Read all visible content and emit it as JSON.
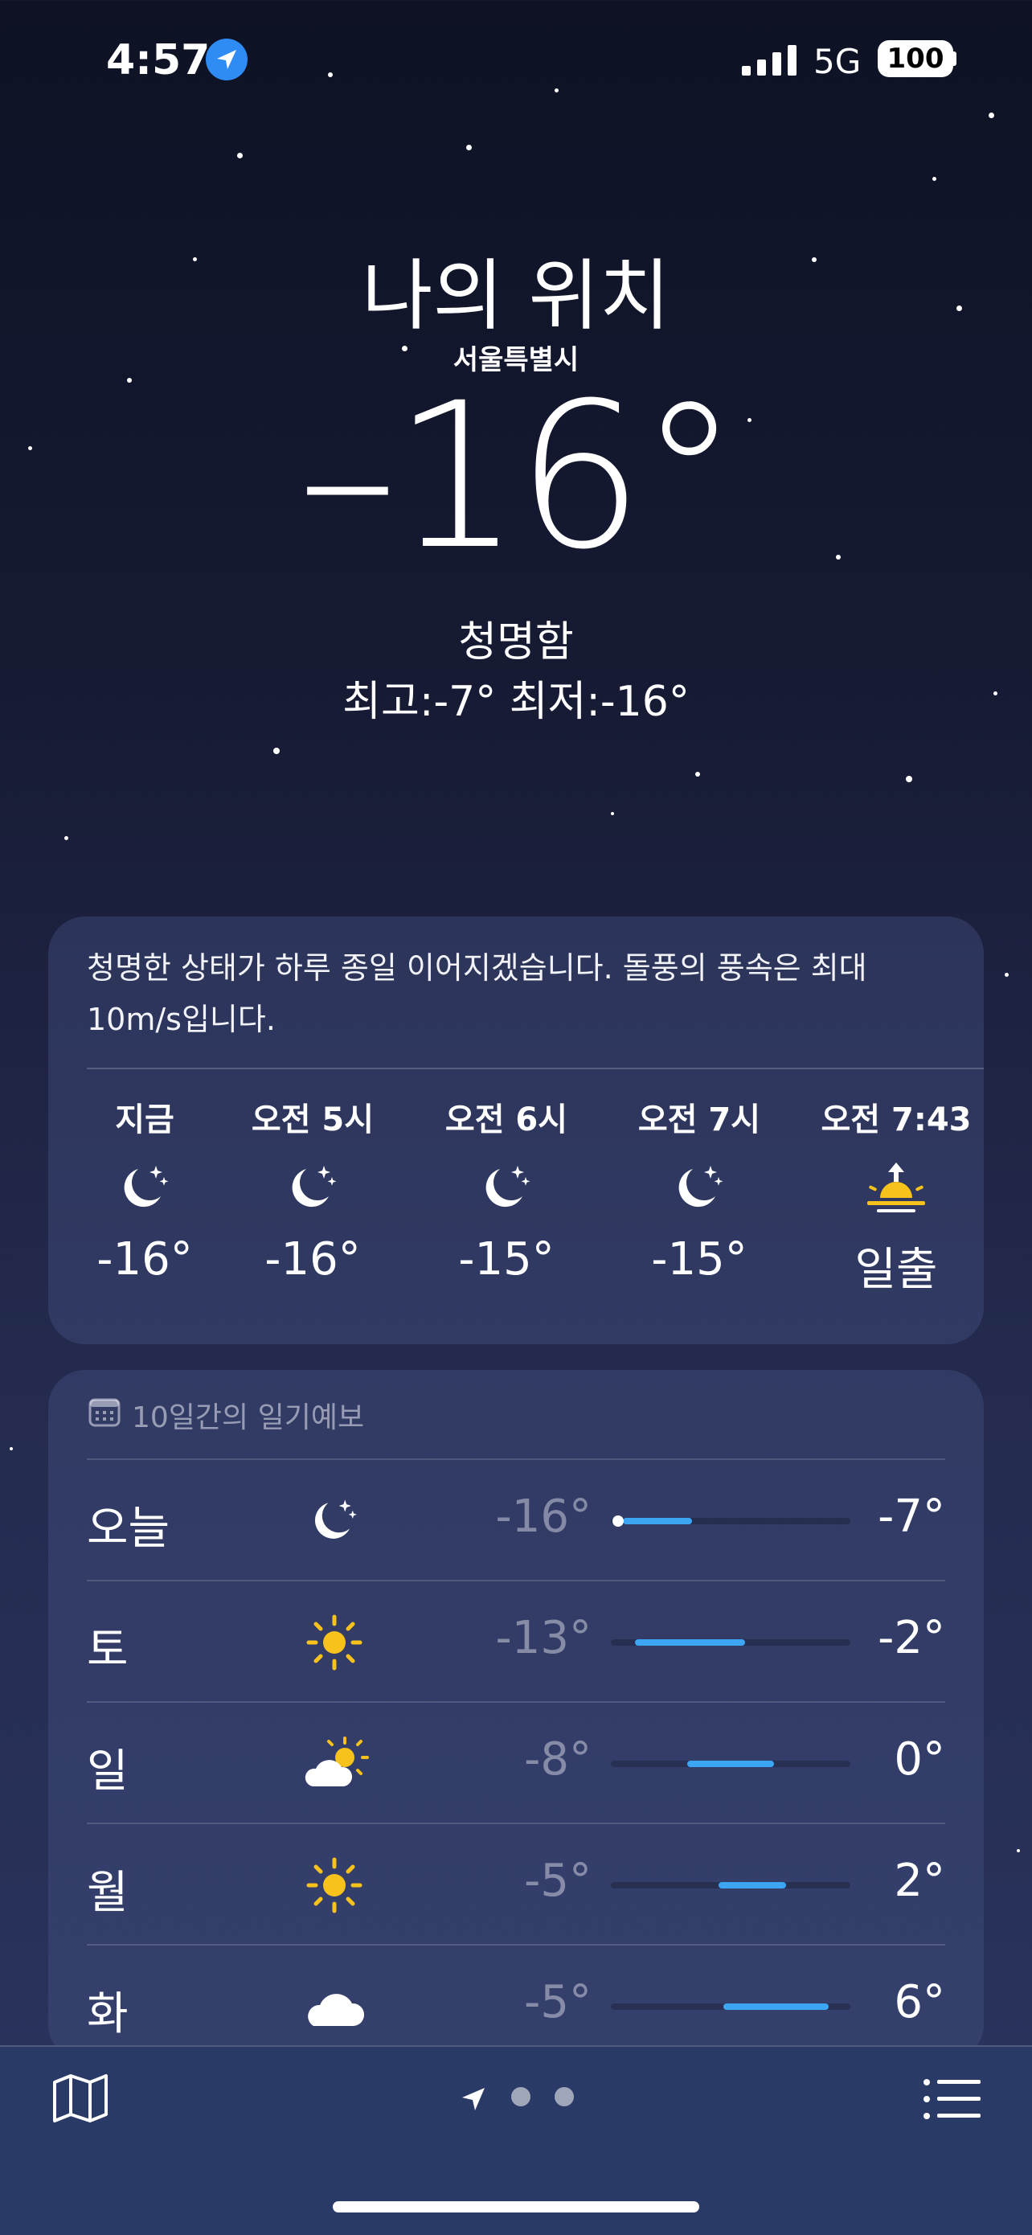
{
  "status": {
    "time": "4:57",
    "network": "5G",
    "battery": "100"
  },
  "header": {
    "location_title": "나의 위치",
    "location_subtitle": "서울특별시",
    "current_temp": "–16°",
    "condition": "청명함",
    "high_low": "최고:-7°  최저:-16°"
  },
  "summary": {
    "text": "청명한 상태가 하루 종일 이어지겠습니다. 돌풍의 풍속은 최대 10m/s입니다.",
    "hours": [
      {
        "time": "지금",
        "icon": "moon-stars-icon",
        "temp": "-16°"
      },
      {
        "time": "오전 5시",
        "icon": "moon-stars-icon",
        "temp": "-16°"
      },
      {
        "time": "오전 6시",
        "icon": "moon-stars-icon",
        "temp": "-15°"
      },
      {
        "time": "오전 7시",
        "icon": "moon-stars-icon",
        "temp": "-15°"
      },
      {
        "time": "오전 7:43",
        "icon": "sunrise-icon",
        "temp": "일출"
      }
    ]
  },
  "forecast": {
    "header": "10일간의 일기예보",
    "days": [
      {
        "day": "오늘",
        "icon": "moon-stars-icon",
        "low": "-16°",
        "high": "-7°",
        "range_start": 0.05,
        "range_end": 0.34,
        "current_marker": true
      },
      {
        "day": "토",
        "icon": "sun-icon",
        "low": "-13°",
        "high": "-2°",
        "range_start": 0.1,
        "range_end": 0.56
      },
      {
        "day": "일",
        "icon": "partly-cloudy-icon",
        "low": "-8°",
        "high": "0°",
        "range_start": 0.32,
        "range_end": 0.68
      },
      {
        "day": "월",
        "icon": "sun-icon",
        "low": "-5°",
        "high": "2°",
        "range_start": 0.45,
        "range_end": 0.73
      },
      {
        "day": "화",
        "icon": "cloud-icon",
        "low": "-5°",
        "high": "6°",
        "range_start": 0.47,
        "range_end": 0.91
      }
    ]
  },
  "colors": {
    "accent": "#3ca6f5",
    "sun": "#f7c21b",
    "location": "#2f8cf5"
  }
}
